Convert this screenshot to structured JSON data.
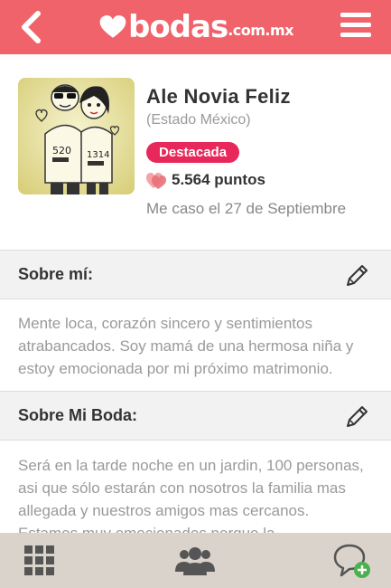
{
  "header": {
    "logo_text": "bodas",
    "logo_domain": ".com.mx",
    "back_icon": "chevron-left-icon",
    "menu_icon": "hamburger-menu-icon"
  },
  "profile": {
    "name": "Ale Novia Feliz",
    "location": "(Estado México)",
    "badge": "Destacada",
    "points": "5.564 puntos",
    "wedding_date": "Me caso el 27 de Septiembre"
  },
  "about": {
    "title": "Sobre mí:",
    "text": "Mente loca, corazón sincero y sentimientos atrabancados. Soy mamá de una hermosa niña y estoy emocionada por mi próximo matrimonio."
  },
  "wedding": {
    "title": "Sobre Mi Boda:",
    "text": "Será en la tarde noche en un jardin, 100 personas, asi que sólo estarán con nosotros la familia mas allegada y nuestros amigos mas cercanos. Estamos muy emocionados porque la"
  },
  "bottom_bar": {
    "grid_icon": "grid-icon",
    "community_icon": "community-icon",
    "new_chat_icon": "chat-add-icon"
  },
  "colors": {
    "brand": "#f0636a",
    "badge": "#e8285a",
    "bottom_bar": "#d9d3cb"
  }
}
